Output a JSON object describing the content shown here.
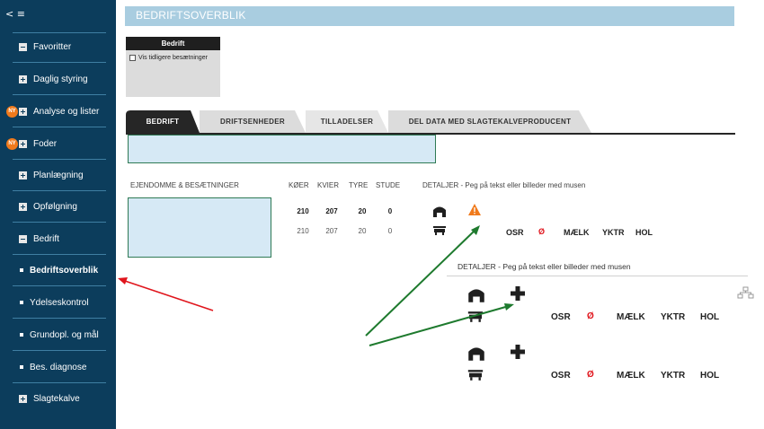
{
  "sidebar": {
    "items": [
      {
        "label": "Favoritter",
        "kind": "minus"
      },
      {
        "label": "Daglig styring",
        "kind": "plus"
      },
      {
        "label": "Analyse og lister",
        "kind": "plus",
        "badge": "NY"
      },
      {
        "label": "Foder",
        "kind": "plus",
        "badge": "NY"
      },
      {
        "label": "Planlægning",
        "kind": "plus"
      },
      {
        "label": "Opfølgning",
        "kind": "plus"
      },
      {
        "label": "Bedrift",
        "kind": "minus"
      },
      {
        "label": "Bedriftsoverblik",
        "kind": "bullet",
        "active": true
      },
      {
        "label": "Ydelseskontrol",
        "kind": "bullet"
      },
      {
        "label": "Grundopl. og mål",
        "kind": "bullet"
      },
      {
        "label": "Bes. diagnose",
        "kind": "bullet"
      },
      {
        "label": "Slagtekalve",
        "kind": "plus"
      }
    ]
  },
  "header": {
    "title": "BEDRIFTSOVERBLIK"
  },
  "filter": {
    "title": "Bedrift",
    "checkbox_label": "Vis tidligere besætninger",
    "checked": false
  },
  "tabs": [
    {
      "label": "BEDRIFT",
      "active": true
    },
    {
      "label": "DRIFTSENHEDER"
    },
    {
      "label": "TILLADELSER"
    },
    {
      "label": "DEL DATA MED SLAGTEKALVEPRODUCENT"
    }
  ],
  "table": {
    "headers": {
      "ejendomme": "EJENDOMME & BESÆTNINGER",
      "koer": "KØER",
      "kvier": "KVIER",
      "tyre": "TYRE",
      "stude": "STUDE",
      "detaljer": "DETALJER - Peg på tekst eller billeder med musen"
    },
    "rows": [
      {
        "koer": "210",
        "kvier": "207",
        "tyre": "20",
        "stude": "0"
      },
      {
        "koer": "210",
        "kvier": "207",
        "tyre": "20",
        "stude": "0"
      }
    ]
  },
  "labels": {
    "osr": "OSR",
    "oe": "Ø",
    "maelk": "MÆLK",
    "yktr": "YKTR",
    "hol": "HOL"
  },
  "detail_panel": {
    "title": "DETALJER - Peg på tekst eller billeder med musen"
  },
  "colors": {
    "sidebar_bg": "#0c3d5c",
    "header_bg": "#a9cde0",
    "warning": "#f07a1c",
    "badge": "#f07a1c",
    "error_red": "#e0151c",
    "arrow_red": "#e0151c",
    "arrow_green": "#1e7a2e"
  }
}
